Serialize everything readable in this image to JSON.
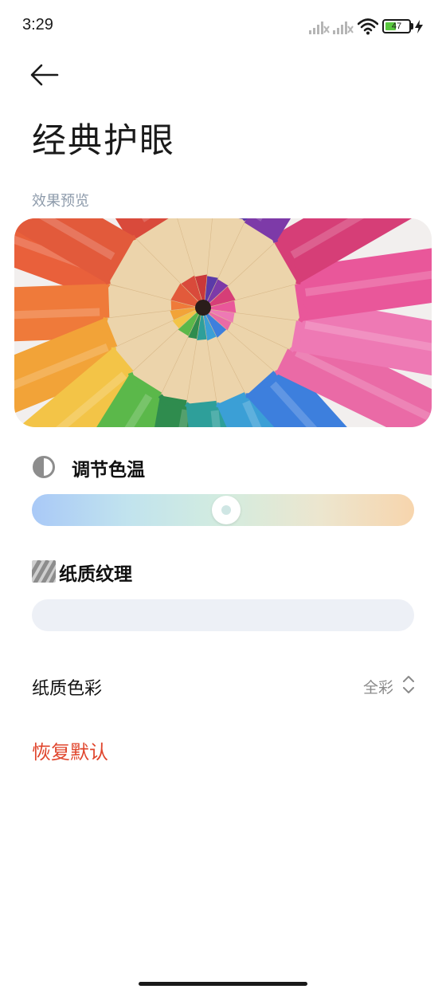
{
  "status_bar": {
    "time": "3:29",
    "battery_level": 47,
    "battery_label": "47",
    "icons": [
      "signal-icon",
      "signal-icon",
      "wifi-icon",
      "battery-icon",
      "charging-icon"
    ]
  },
  "header": {
    "back_icon": "arrow-left-icon",
    "title": "经典护眼"
  },
  "preview": {
    "label": "效果预览"
  },
  "color_temperature": {
    "icon": "contrast-icon",
    "title": "调节色温",
    "value_fraction": 0.51,
    "gradient_colors": [
      "#a9c9f7",
      "#c1e3ee",
      "#d3ecdf",
      "#ece6cf",
      "#f7d5ad"
    ]
  },
  "paper_texture": {
    "icon": "texture-icon",
    "title": "纸质纹理",
    "value_fraction": 0
  },
  "paper_color": {
    "label": "纸质色彩",
    "value": "全彩",
    "icon": "chevron-up-down-icon"
  },
  "reset": {
    "label": "恢复默认",
    "color": "#e0452c"
  }
}
